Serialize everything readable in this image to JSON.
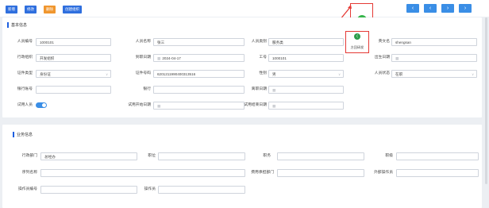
{
  "toolbar": {
    "buttons": [
      {
        "label": "新增",
        "color": "#2f6fde"
      },
      {
        "label": "修改",
        "color": "#2f6fde"
      },
      {
        "label": "删除",
        "color": "#f0962e"
      },
      {
        "label": "创建组织",
        "color": "#2f6fde"
      }
    ],
    "nav": [
      "‹",
      "‹",
      "›",
      "›"
    ]
  },
  "float": {
    "avatar_text": "工单",
    "share_label": "方回研发"
  },
  "basic": {
    "title": "基本信息",
    "rows": [
      [
        {
          "label": "人员编号",
          "value": "1000101"
        },
        {
          "label": "人员名称",
          "value": "张三"
        },
        {
          "label": "人员类别",
          "value": "服务类"
        },
        {
          "label": "英文名",
          "value": "shengsan"
        }
      ],
      [
        {
          "label": "行政组织",
          "value": "开发组织"
        },
        {
          "label": "到职日期",
          "value": "2024-04-17"
        },
        {
          "label": "工号",
          "value": "1000101"
        },
        {
          "label": "出生日期",
          "value": ""
        }
      ],
      [
        {
          "label": "证件类型",
          "value": "身份证"
        },
        {
          "label": "证件号码",
          "value": "6201211990400313516"
        },
        {
          "label": "性别",
          "value": "男"
        },
        {
          "label": "人员状态",
          "value": "在职"
        }
      ],
      [
        {
          "label": "银行账号",
          "value": ""
        },
        {
          "label": "银行",
          "value": ""
        },
        {
          "label": "离职日期",
          "value": ""
        }
      ]
    ],
    "trial_label": "试用人员",
    "trial_start_label": "试用开始日期",
    "trial_end_label": "试用结束日期"
  },
  "business": {
    "title": "业务信息",
    "rows": [
      [
        {
          "label": "行政部门",
          "value": "总经办"
        },
        {
          "label": "职位",
          "value": ""
        },
        {
          "label": "职务",
          "value": ""
        },
        {
          "label": "职级",
          "value": ""
        }
      ],
      [
        {
          "label": "序列名称",
          "value": ""
        },
        {
          "label": "费用承担部门",
          "value": ""
        },
        {
          "label": "外部操作员",
          "value": ""
        }
      ],
      [
        {
          "label": "操作员编号",
          "value": ""
        },
        {
          "label": "操作员",
          "value": ""
        }
      ]
    ]
  },
  "colors": {
    "primary": "#2f6fde",
    "warning": "#f0962e",
    "annotation": "#e53935",
    "share": "#2e9d4b"
  }
}
